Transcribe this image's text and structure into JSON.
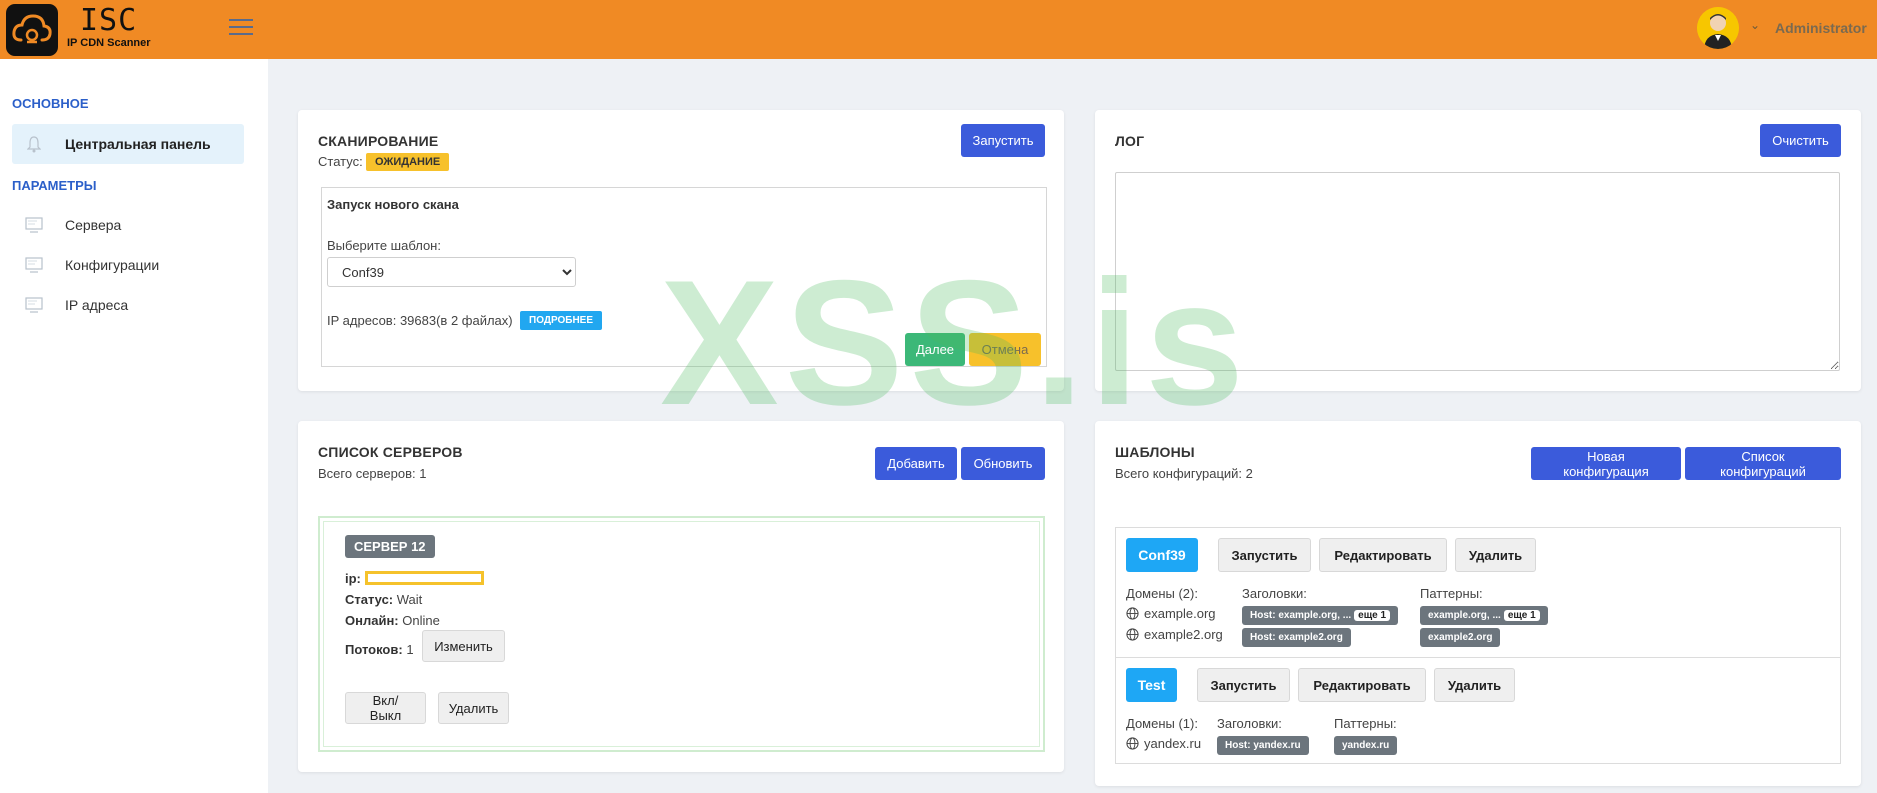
{
  "app": {
    "title": "ISC",
    "subtitle": "IP CDN Scanner"
  },
  "header": {
    "user_name": "Administrator"
  },
  "sidebar": {
    "sections": [
      "ОСНОВНОЕ",
      "ПАРАМЕТРЫ"
    ],
    "active_item": "Центральная панель",
    "items": [
      "Сервера",
      "Конфигурации",
      "IP адреса"
    ]
  },
  "scan": {
    "title": "СКАНИРОВАНИЕ",
    "status_label": "Статус:",
    "status_value": "ОЖИДАНИЕ",
    "start_button": "Запустить",
    "new_scan_title": "Запуск нового скана",
    "template_label": "Выберите шаблон:",
    "template_selected": "Conf39",
    "ip_info": "IP адресов: 39683(в 2 файлах)",
    "details_badge": "ПОДРОБНЕЕ",
    "next_button": "Далее",
    "cancel_button": "Отмена"
  },
  "log": {
    "title": "ЛОГ",
    "clear_button": "Очистить"
  },
  "servers": {
    "title": "СПИСОК СЕРВЕРОВ",
    "total": "Всего серверов: 1",
    "add_button": "Добавить",
    "refresh_button": "Обновить",
    "server_name": "СЕРВЕР 12",
    "ip_label": "ip:",
    "status_label": "Статус:",
    "status_value": "Wait",
    "online_label": "Онлайн:",
    "online_value": "Online",
    "threads_label": "Потоков:",
    "threads_value": "1",
    "edit_button": "Изменить",
    "toggle_button": "Вкл/Выкл",
    "delete_button": "Удалить"
  },
  "templates": {
    "title": "ШАБЛОНЫ",
    "total": "Всего конфигураций: 2",
    "new_button": "Новая конфигурация",
    "list_button": "Список конфигураций",
    "items": [
      {
        "name": "Conf39",
        "run": "Запустить",
        "edit": "Редактировать",
        "delete": "Удалить",
        "domains_label": "Домены (2):",
        "domains": [
          "example.org",
          "example2.org"
        ],
        "headers_label": "Заголовки:",
        "headers": [
          "Host: example.org, ...",
          "Host: example2.org"
        ],
        "headers_more": "еще 1",
        "patterns_label": "Паттерны:",
        "patterns": [
          "example.org, ...",
          "example2.org"
        ],
        "patterns_more": "еще 1"
      },
      {
        "name": "Test",
        "run": "Запустить",
        "edit": "Редактировать",
        "delete": "Удалить",
        "domains_label": "Домены (1):",
        "domains": [
          "yandex.ru"
        ],
        "headers_label": "Заголовки:",
        "headers": [
          "Host: yandex.ru"
        ],
        "patterns_label": "Паттерны:",
        "patterns": [
          "yandex.ru"
        ]
      }
    ]
  },
  "watermark": "XSS.is",
  "colors": {
    "header": "#f08a24",
    "primary": "#3b5bdb",
    "info": "#1ea7f5",
    "warning": "#f7c12b",
    "success": "#3cb878"
  }
}
